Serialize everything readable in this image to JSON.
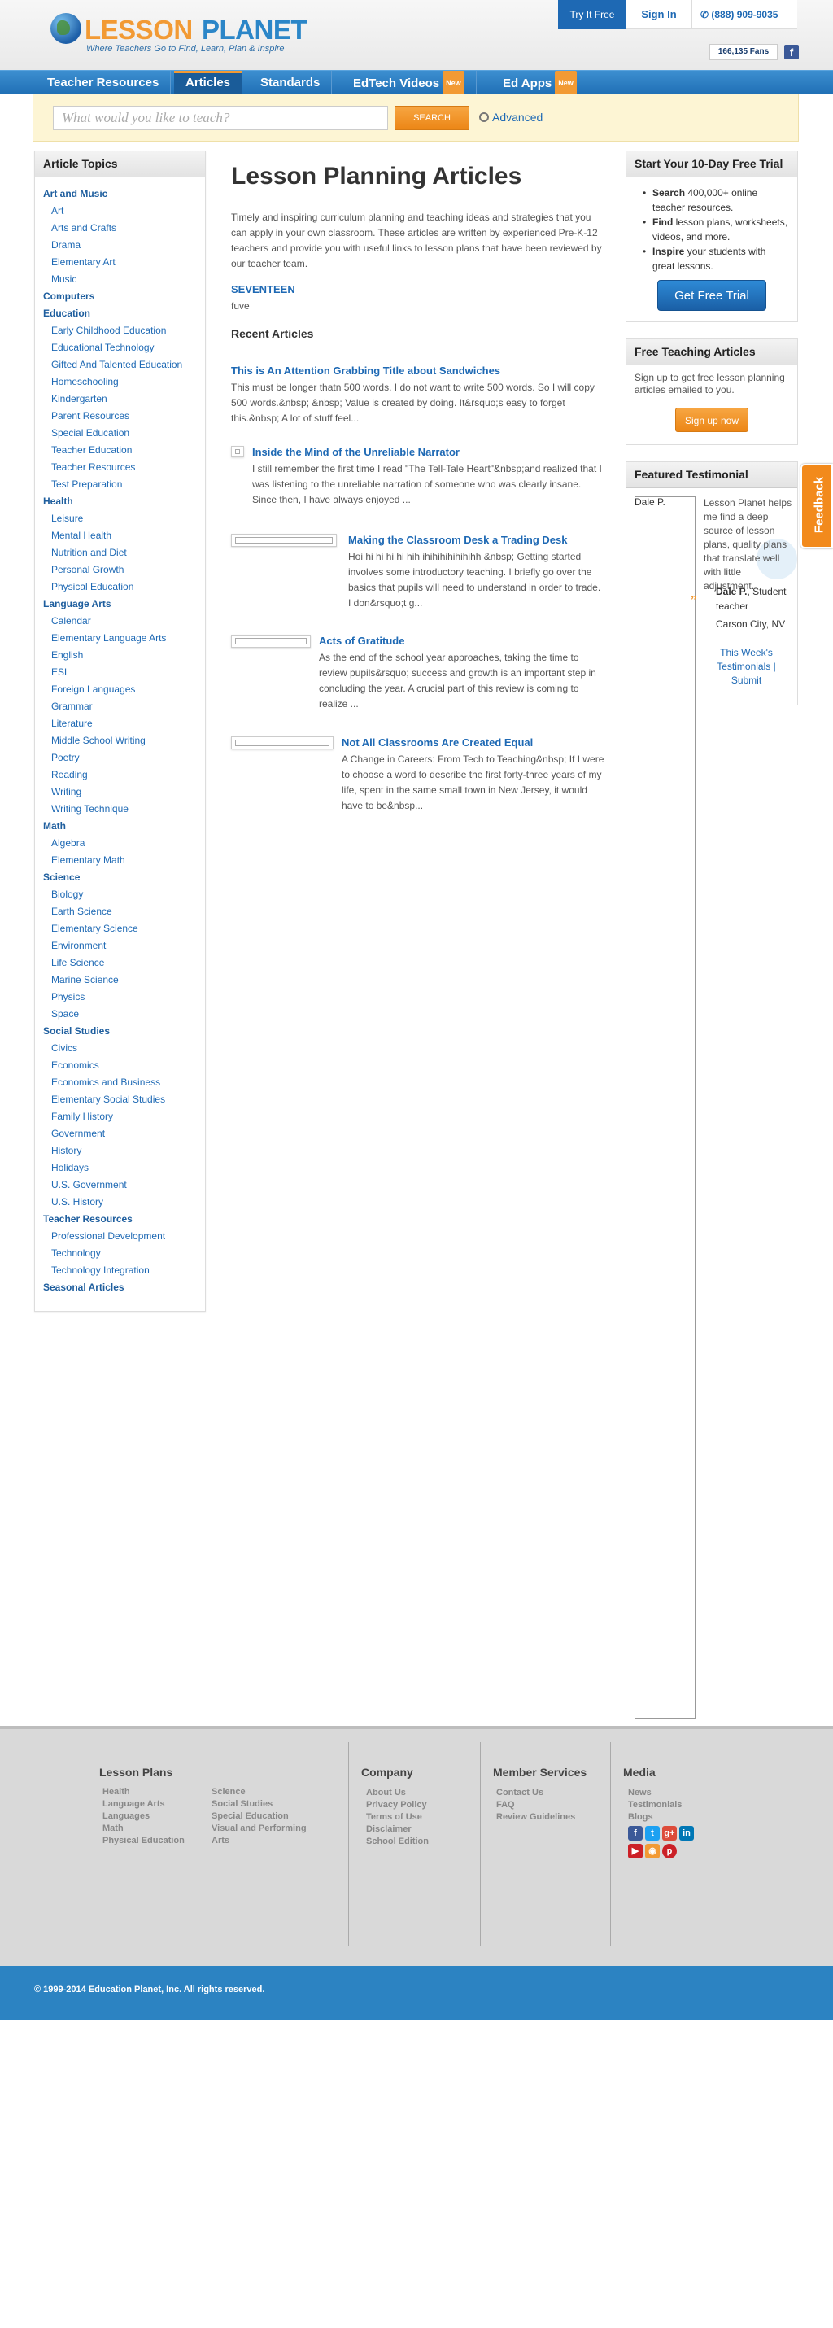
{
  "header": {
    "logo_word1": "LESSON",
    "logo_word2": "PLANET",
    "tagline": "Where Teachers Go to Find, Learn, Plan & Inspire",
    "try_free": "Try It Free",
    "sign_in": "Sign In",
    "phone": "(888) 909-9035",
    "fans": "166,135 Fans",
    "fb": "f"
  },
  "nav": {
    "items": [
      "Teacher Resources",
      "Articles",
      "Standards",
      "EdTech Videos",
      "Ed Apps"
    ],
    "new_badge": "New",
    "active": "Articles"
  },
  "search": {
    "placeholder": "What would you like to teach?",
    "button": "SEARCH",
    "advanced": "Advanced"
  },
  "sidebar": {
    "title": "Article Topics",
    "items": [
      {
        "label": "Art and Music",
        "level": "top"
      },
      {
        "label": "Art",
        "level": "sub"
      },
      {
        "label": "Arts and Crafts",
        "level": "sub"
      },
      {
        "label": "Drama",
        "level": "sub"
      },
      {
        "label": "Elementary Art",
        "level": "sub"
      },
      {
        "label": "Music",
        "level": "sub"
      },
      {
        "label": "Computers",
        "level": "top"
      },
      {
        "label": "Education",
        "level": "top"
      },
      {
        "label": "Early Childhood Education",
        "level": "sub"
      },
      {
        "label": "Educational Technology",
        "level": "sub"
      },
      {
        "label": "Gifted And Talented Education",
        "level": "sub"
      },
      {
        "label": "Homeschooling",
        "level": "sub"
      },
      {
        "label": "Kindergarten",
        "level": "sub"
      },
      {
        "label": "Parent Resources",
        "level": "sub"
      },
      {
        "label": "Special Education",
        "level": "sub"
      },
      {
        "label": "Teacher Education",
        "level": "sub"
      },
      {
        "label": "Teacher Resources",
        "level": "sub"
      },
      {
        "label": "Test Preparation",
        "level": "sub"
      },
      {
        "label": "Health",
        "level": "top"
      },
      {
        "label": "Leisure",
        "level": "sub"
      },
      {
        "label": "Mental Health",
        "level": "sub"
      },
      {
        "label": "Nutrition and Diet",
        "level": "sub"
      },
      {
        "label": "Personal Growth",
        "level": "sub"
      },
      {
        "label": "Physical Education",
        "level": "sub"
      },
      {
        "label": "Language Arts",
        "level": "top"
      },
      {
        "label": "Calendar",
        "level": "sub"
      },
      {
        "label": "Elementary Language Arts",
        "level": "sub"
      },
      {
        "label": "English",
        "level": "sub"
      },
      {
        "label": "ESL",
        "level": "sub"
      },
      {
        "label": "Foreign Languages",
        "level": "sub"
      },
      {
        "label": "Grammar",
        "level": "sub"
      },
      {
        "label": "Literature",
        "level": "sub"
      },
      {
        "label": "Middle School Writing",
        "level": "sub"
      },
      {
        "label": "Poetry",
        "level": "sub"
      },
      {
        "label": "Reading",
        "level": "sub"
      },
      {
        "label": "Writing",
        "level": "sub"
      },
      {
        "label": "Writing Technique",
        "level": "sub"
      },
      {
        "label": "Math",
        "level": "top"
      },
      {
        "label": "Algebra",
        "level": "sub"
      },
      {
        "label": "Elementary Math",
        "level": "sub"
      },
      {
        "label": "Science",
        "level": "top"
      },
      {
        "label": "Biology",
        "level": "sub"
      },
      {
        "label": "Earth Science",
        "level": "sub"
      },
      {
        "label": "Elementary Science",
        "level": "sub"
      },
      {
        "label": "Environment",
        "level": "sub"
      },
      {
        "label": "Life Science",
        "level": "sub"
      },
      {
        "label": "Marine Science",
        "level": "sub"
      },
      {
        "label": "Physics",
        "level": "sub"
      },
      {
        "label": "Space",
        "level": "sub"
      },
      {
        "label": "Social Studies",
        "level": "top"
      },
      {
        "label": "Civics",
        "level": "sub"
      },
      {
        "label": "Economics",
        "level": "sub"
      },
      {
        "label": "Economics and Business",
        "level": "sub"
      },
      {
        "label": "Elementary Social Studies",
        "level": "sub"
      },
      {
        "label": "Family History",
        "level": "sub"
      },
      {
        "label": "Government",
        "level": "sub"
      },
      {
        "label": "History",
        "level": "sub"
      },
      {
        "label": "Holidays",
        "level": "sub"
      },
      {
        "label": "U.S. Government",
        "level": "sub"
      },
      {
        "label": "U.S. History",
        "level": "sub"
      },
      {
        "label": "Teacher Resources",
        "level": "top"
      },
      {
        "label": "Professional Development",
        "level": "sub"
      },
      {
        "label": "Technology",
        "level": "sub"
      },
      {
        "label": "Technology Integration",
        "level": "sub"
      },
      {
        "label": "Seasonal Articles",
        "level": "top"
      }
    ]
  },
  "main": {
    "title": "Lesson Planning Articles",
    "intro": "Timely and inspiring curriculum planning and teaching ideas and strategies that you can apply in your own classroom. These articles are written by experienced Pre-K-12 teachers and provide you with useful links to lesson plans that have been reviewed by our teacher team.",
    "seventeen": "SEVENTEEN",
    "fuve": "fuve",
    "recent_heading": "Recent Articles",
    "articles": [
      {
        "title": "This is An Attention Grabbing Title about Sandwiches",
        "desc": "This must be longer thatn 500 words. I do not want to write 500 words. So I will copy 500 words.&nbsp; &nbsp; Value is created by doing. It&rsquo;s easy to forget this.&nbsp; A lot of stuff feel..."
      },
      {
        "title": "Inside the Mind of the Unreliable Narrator",
        "desc": "I still remember the first time I read \"The Tell-Tale Heart\"&nbsp;and realized that I was listening to the unreliable narration of someone who was clearly insane. Since then, I have always enjoyed ..."
      },
      {
        "title": "Making the Classroom Desk a Trading Desk",
        "desc": "Hoi hi hi hi hi hih ihihihihihihihh &nbsp; Getting started involves some introductory teaching. I briefly go over the basics that pupils will need to understand in order to trade. I don&rsquo;t g..."
      },
      {
        "title": "Acts of Gratitude",
        "desc": "As the end of the school year approaches, taking the time to review pupils&rsquo; success and growth is an important step in concluding the year. A crucial part of this review is coming to realize ..."
      },
      {
        "title": "Not All Classrooms Are Created Equal",
        "desc": "A Change in Careers: From Tech to Teaching&nbsp; If I were to choose a word to describe the first forty-three years of my life, spent in the same small town in New Jersey, it would have to be&nbsp..."
      }
    ]
  },
  "trial": {
    "title": "Start Your 10-Day Free Trial",
    "bullets": [
      {
        "bold": "Search",
        "text": " 400,000+ online teacher resources."
      },
      {
        "bold": "Find",
        "text": " lesson plans, worksheets, videos, and more."
      },
      {
        "bold": "Inspire",
        "text": " your students with great lessons."
      }
    ],
    "button": "Get Free Trial"
  },
  "free_articles": {
    "title": "Free Teaching Articles",
    "text": "Sign up to get free lesson planning articles emailed to you.",
    "button": "Sign up now"
  },
  "testimonial": {
    "title": "Featured Testimonial",
    "name": "Dale P.",
    "quote": "Lesson Planet helps me find a deep source of lesson plans, quality plans that translate well with little adjustment.",
    "author_name": "Dale P.",
    "author_role": ", Student teacher",
    "location": "Carson City, NV",
    "link1": "This Week's Testimonials",
    "sep": "|",
    "link2": "Submit"
  },
  "feedback": "Feedback",
  "footer": {
    "lesson_plans": {
      "title": "Lesson Plans",
      "col1": [
        "Health",
        "Language Arts",
        "Languages",
        "Math",
        "Physical Education"
      ],
      "col2": [
        "Science",
        "Social Studies",
        "Special Education",
        "Visual and Performing Arts"
      ]
    },
    "company": {
      "title": "Company",
      "links": [
        "About Us",
        "Privacy Policy",
        "Terms of Use",
        "Disclaimer",
        "School Edition"
      ]
    },
    "member": {
      "title": "Member Services",
      "links": [
        "Contact Us",
        "FAQ",
        "Review Guidelines"
      ]
    },
    "media": {
      "title": "Media",
      "links": [
        "News",
        "Testimonials",
        "Blogs"
      ]
    },
    "social_icons": [
      "facebook-icon",
      "twitter-icon",
      "google-plus-icon",
      "linkedin-icon",
      "youtube-icon",
      "rss-icon",
      "pinterest-icon"
    ],
    "copyright": "© 1999-2014 Education Planet, Inc. All rights reserved."
  },
  "colors": {
    "brand_blue": "#1e69b4",
    "brand_orange": "#f29a34",
    "footer_bar": "#2c83c2"
  }
}
